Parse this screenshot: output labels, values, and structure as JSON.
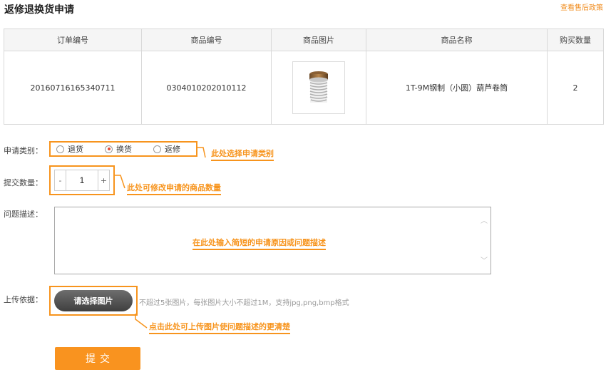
{
  "header": {
    "title": "返修退换货申请",
    "policy_link": "查看售后政策"
  },
  "table": {
    "columns": [
      "订单编号",
      "商品编号",
      "商品图片",
      "商品名称",
      "购买数量"
    ],
    "row": {
      "order_no": "20160716165340711",
      "product_no": "0304010202010112",
      "product_image_icon": "spring-part-photo",
      "product_name": "1T-9M钢制（小圆）葫芦卷筒",
      "quantity": "2"
    }
  },
  "form": {
    "type_label": "申请类别：",
    "type_options": [
      {
        "label": "退货",
        "checked": false
      },
      {
        "label": "换货",
        "checked": true
      },
      {
        "label": "返修",
        "checked": false
      }
    ],
    "qty_label": "提交数量：",
    "qty_value": "1",
    "minus_label": "-",
    "plus_label": "+",
    "desc_label": "问题描述：",
    "desc_placeholder": "在此处输入简短的申请原因或问题描述",
    "upload_label": "上传依据：",
    "upload_button": "请选择图片",
    "upload_hint": "不超过5张图片，每张图片大小不超过1M，支持jpg,png,bmp格式",
    "submit": "提交"
  },
  "callouts": {
    "type": "此处选择申请类别",
    "qty": "此处可修改申请的商品数量",
    "upload": "点击此处可上传图片使问题描述的更清楚"
  },
  "colors": {
    "accent": "#f7941d",
    "radio_checked": "#e24a3b"
  }
}
